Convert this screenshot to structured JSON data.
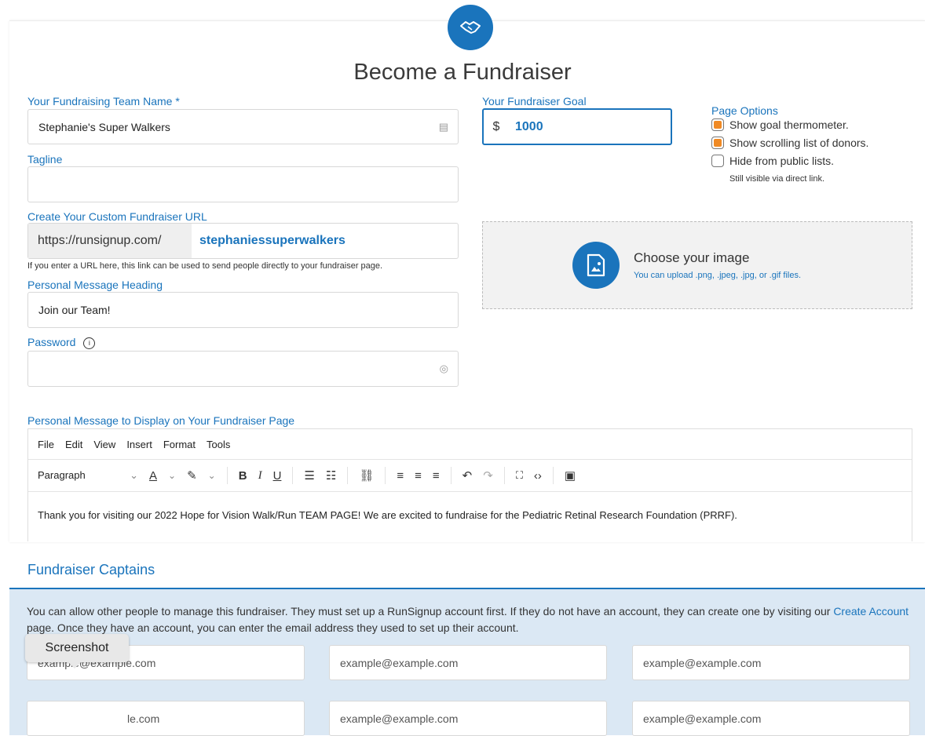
{
  "form": {
    "title": "Become a Fundraiser",
    "team_name": {
      "label": "Your Fundraising Team Name *",
      "value": "Stephanie's Super Walkers"
    },
    "tagline": {
      "label": "Tagline",
      "value": ""
    },
    "url": {
      "label": "Create Your Custom Fundraiser URL",
      "prefix": "https://runsignup.com/",
      "value": "stephaniessuperwalkers",
      "help": "If you enter a URL here, this link can be used to send people directly to your fundraiser page."
    },
    "heading": {
      "label": "Personal Message Heading",
      "value": "Join our Team!"
    },
    "password": {
      "label": "Password",
      "value": ""
    },
    "goal": {
      "label": "Your Fundraiser Goal",
      "currency": "$",
      "value": "1000"
    },
    "page_options": {
      "label": "Page Options",
      "items": [
        {
          "label": "Show goal thermometer.",
          "checked": true
        },
        {
          "label": "Show scrolling list of donors.",
          "checked": true
        },
        {
          "label": "Hide from public lists.",
          "checked": false
        }
      ],
      "note": "Still visible via direct link."
    },
    "image": {
      "title": "Choose your image",
      "subtitle": "You can upload .png, .jpeg, .jpg, or .gif files."
    },
    "message": {
      "label": "Personal Message to Display on Your Fundraiser Page",
      "menu": [
        "File",
        "Edit",
        "View",
        "Insert",
        "Format",
        "Tools"
      ],
      "block_format": "Paragraph",
      "body": "Thank you for visiting our 2022 Hope for Vision Walk/Run TEAM PAGE! We are excited to fundraise for the Pediatric Retinal Research Foundation (PRRF)."
    }
  },
  "captains": {
    "title": "Fundraiser Captains",
    "text_before": "You can allow other people to manage this fundraiser. They must set up a RunSignup account first. If they do not have an account, they can create one by visiting our",
    "link": "Create Account",
    "text_after": "page. Once they have an account, you can enter the email address they used to set up their account.",
    "placeholders": [
      "example@example.com",
      "example@example.com",
      "example@example.com",
      "le.com",
      "example@example.com",
      "example@example.com"
    ]
  },
  "tooltip": "Screenshot",
  "colors": {
    "accent": "#1a74bc",
    "checkbox": "#f08a24",
    "panel": "#dbe8f4"
  }
}
